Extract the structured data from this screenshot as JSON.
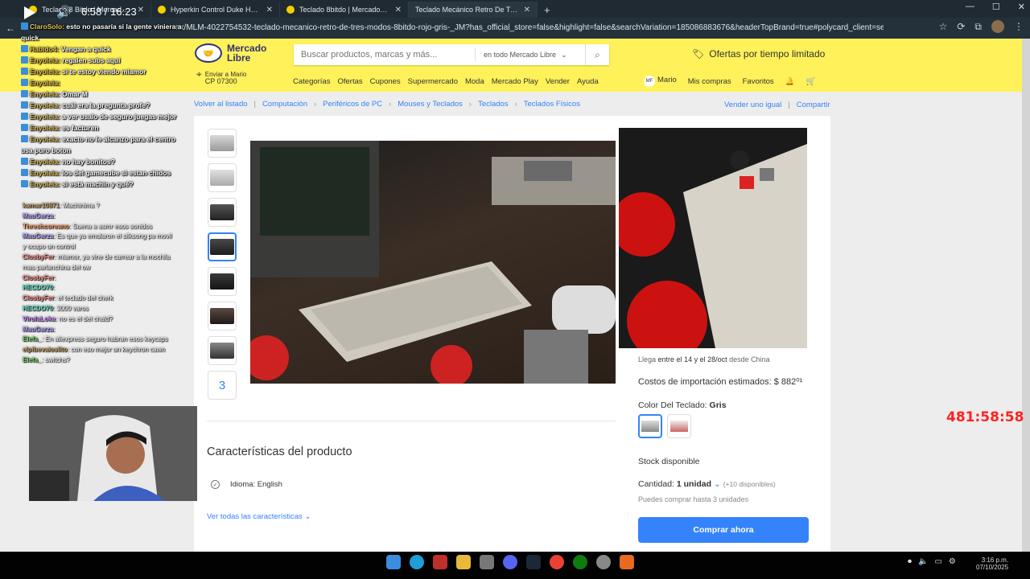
{
  "browser": {
    "tabs": [
      {
        "label": "Teclado 8 Bitdo | MercadoLibre 📦"
      },
      {
        "label": "Hyperkin Control Duke Halo 20th"
      },
      {
        "label": "Teclado 8bitdo | MercadoLibre 📦"
      },
      {
        "label": "Teclado Mecánico Retro De Tres M"
      }
    ],
    "url": "nx/MLM-4022754532-teclado-mecanico-retro-de-tres-modos-8bitdo-rojo-gris-_JM?has_official_store=false&highlight=false&searchVariation=185086883676&headerTopBrand=true#polycard_client=search-n..."
  },
  "header": {
    "logo_line1": "Mercado",
    "logo_line2": "Libre",
    "search_placeholder": "Buscar productos, marcas y más...",
    "search_scope": "en todo Mercado Libre",
    "offers": "Ofertas por tiempo limitado",
    "ship_to": "Enviar a Mario",
    "ship_cp": "CP 07300",
    "nav": [
      "Categorías",
      "Ofertas",
      "Cupones",
      "Supermercado",
      "Moda",
      "Mercado Play",
      "Vender",
      "Ayuda"
    ],
    "user_initials": "MF",
    "user_name": "Mario",
    "my_purchases": "Mis compras",
    "favorites": "Favoritos"
  },
  "breadcrumb": {
    "back": "Volver al listado",
    "items": [
      "Computación",
      "Periféricos de PC",
      "Mouses y Teclados",
      "Teclados",
      "Teclados Físicos"
    ],
    "sell_same": "Vender uno igual",
    "share": "Compartir"
  },
  "product": {
    "thumb_more": "3",
    "arrive_prefix": "Llega",
    "arrive_dates": "entre el 14 y el 28/oct",
    "arrive_suffix": "desde China",
    "import_costs": "Costos de importación estimados: $ 882⁰¹",
    "color_label": "Color Del Teclado:",
    "color_value": "Gris",
    "stock": "Stock disponible",
    "qty_label": "Cantidad:",
    "qty_value": "1 unidad",
    "qty_available": "(+10 disponibles)",
    "max_buy": "Puedes comprar hasta 3 unidades",
    "buy_button": "Comprar ahora",
    "features_title": "Características del producto",
    "feature_label": "Idioma:",
    "feature_value": "English",
    "all_features": "Ver todas las características"
  },
  "chat_top": [
    {
      "user": "ClaroSolo:",
      "text": "esto no pasaría si la gente viniera a quick"
    },
    {
      "user": "Habido4:",
      "text": "Vengan a quick"
    },
    {
      "user": "Enyoleia:",
      "text": "regalen subs aquí"
    },
    {
      "user": "Enyoleia:",
      "text": "si te estoy viendo miamor"
    },
    {
      "user": "Enyoleia:",
      "text": ""
    },
    {
      "user": "Enyoleia:",
      "text": "Omar M"
    },
    {
      "user": "Enyoleia:",
      "text": "cuál era la pregunta profe?"
    },
    {
      "user": "Enyoleia:",
      "text": "a ver usalo de seguro juegas mejor"
    },
    {
      "user": "Enyoleia:",
      "text": "es facturen"
    },
    {
      "user": "Enyoleia:",
      "text": "exacto no le alcanzo para el centro usa puro boton"
    },
    {
      "user": "Enyoleia:",
      "text": "no hay bonitos?"
    },
    {
      "user": "Enyoleia:",
      "text": "los del gamecube si estan chidos"
    },
    {
      "user": "Enyoleia:",
      "text": "si está machin y qué?"
    }
  ],
  "chat_bottom": [
    {
      "user": "kamar10871",
      "text": ": Machinima ?"
    },
    {
      "user": "MauGarza",
      "text": ":"
    },
    {
      "user": "Threshcoreano",
      "text": ": Suena a asmr esos sonidos"
    },
    {
      "user": "MauGarza",
      "text": ": Es que ya emularon el silksong pa movil y ocupo un control"
    },
    {
      "user": "ClosbyFer",
      "text": ": miamor, ya vine de carrear a la mochila mas parlanchina del ow"
    },
    {
      "user": "ClosbyFer",
      "text": ":"
    },
    {
      "user": "HECDO70",
      "text": ":"
    },
    {
      "user": "ClosbyFer",
      "text": ": el teclado del cherk"
    },
    {
      "user": "HECDO70",
      "text": ": 3000 varos"
    },
    {
      "user": "VirulaLoka",
      "text": ": no es el del chald?"
    },
    {
      "user": "MauGarza",
      "text": ":"
    },
    {
      "user": "Elefa_",
      "text": ": En aliexpress seguro habran esos keycaps"
    },
    {
      "user": "elpibevaioslito",
      "text": ": con eso mejor un keychron cawn"
    },
    {
      "user": "Elefa_",
      "text": ": switchs?"
    }
  ],
  "stream_timer": "481:58:58",
  "video": {
    "time": "6:58 / 16:23"
  },
  "taskbar": {
    "clock_time": "3:16 p.m.",
    "clock_date": "07/10/2025"
  },
  "colors": {
    "ml_yellow": "#fff159",
    "ml_blue": "#3483fa",
    "timer_red": "#ff2222"
  }
}
